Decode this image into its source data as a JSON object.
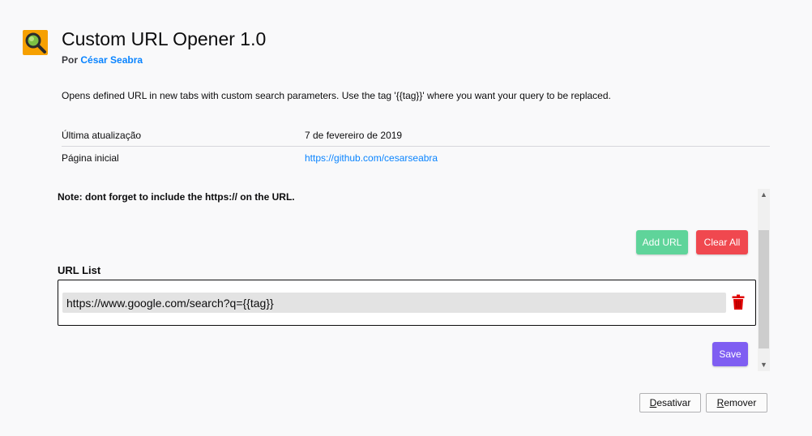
{
  "addon": {
    "name": "Custom URL Opener 1.0",
    "by_prefix": "Por",
    "author": "César Seabra",
    "description": "Opens defined URL in new tabs with custom search parameters. Use the tag '{{tag}}' where you want your query to be replaced.",
    "icon": "magnifier-icon",
    "icon_color": "#f6a000"
  },
  "details": {
    "last_updated_label": "Última atualização",
    "last_updated_value": "7 de fevereiro de 2019",
    "homepage_label": "Página inicial",
    "homepage_value": "https://github.com/cesarseabra"
  },
  "options": {
    "note": "Note: dont forget to include the https:// on the URL.",
    "add_url_label": "Add URL",
    "clear_all_label": "Clear All",
    "url_list_label": "URL List",
    "urls": [
      "https://www.google.com/search?q={{tag}}"
    ],
    "save_label": "Save",
    "colors": {
      "add": "#5fd49a",
      "clear": "#f0484f",
      "save": "#7f5ef2",
      "trash": "#e00000"
    }
  },
  "footer": {
    "disable_first": "D",
    "disable_rest": "esativar",
    "remove_first": "R",
    "remove_rest": "emover"
  }
}
